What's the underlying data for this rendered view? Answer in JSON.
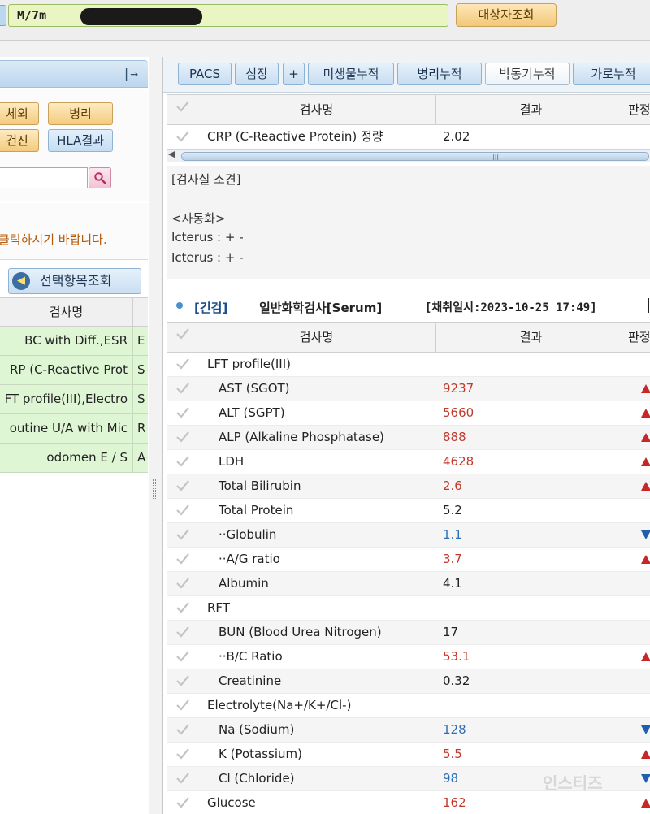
{
  "topbar": {
    "patient_info": "M/7m",
    "lookup_button": "대상자조회"
  },
  "left_panel": {
    "header_icon": "collapse-right-icon",
    "buttons": [
      {
        "label": "체외",
        "style": "orange"
      },
      {
        "label": "병리",
        "style": "orange"
      },
      {
        "label": "건진",
        "style": "orange"
      },
      {
        "label": "HLA결과",
        "style": "blue"
      }
    ],
    "search": {
      "value": "",
      "icon": "search-icon"
    },
    "notice": "클릭하시기 바랍니다.",
    "select_button": "선택항목조회",
    "table": {
      "header": "검사명",
      "rows": [
        {
          "name": "BC with Diff.,ESR",
          "code": "E"
        },
        {
          "name": "RP (C-Reactive Prot",
          "code": "S"
        },
        {
          "name": "FT profile(III),Electro",
          "code": "S"
        },
        {
          "name": "outine U/A with Mic",
          "code": "R"
        },
        {
          "name": "odomen E / S",
          "code": "A"
        }
      ]
    }
  },
  "tabs": [
    {
      "label": "PACS",
      "active": false
    },
    {
      "label": "심장",
      "active": false
    },
    {
      "label": "+",
      "active": false
    },
    {
      "label": "미생물누적",
      "active": false
    },
    {
      "label": "병리누적",
      "active": false
    },
    {
      "label": "박동기누적",
      "active": true
    },
    {
      "label": "가로누적",
      "active": false
    }
  ],
  "grid_headers": {
    "name": "검사명",
    "result": "결과",
    "flag": "판정"
  },
  "top_grid": {
    "rows": [
      {
        "name": "CRP (C-Reactive Protein) 정량",
        "result": "2.02"
      }
    ]
  },
  "opinion": {
    "title": "[검사실 소견]",
    "lines": [
      "<자동화>",
      "Icterus : + -",
      "Icterus : + -"
    ]
  },
  "section": {
    "tag": "[긴검]",
    "name": "일반화학검사[Serum]",
    "collected": "[채취일시:2023-10-25 17:49]"
  },
  "results": [
    {
      "name": "LFT profile(III)",
      "result": "",
      "level": "group",
      "status": "normal"
    },
    {
      "name": "AST (SGOT)",
      "result": "9237",
      "level": "item",
      "status": "high"
    },
    {
      "name": "ALT (SGPT)",
      "result": "5660",
      "level": "item",
      "status": "high"
    },
    {
      "name": "ALP (Alkaline Phosphatase)",
      "result": "888",
      "level": "item",
      "status": "high"
    },
    {
      "name": "LDH",
      "result": "4628",
      "level": "item",
      "status": "high"
    },
    {
      "name": "Total Bilirubin",
      "result": "2.6",
      "level": "item",
      "status": "high"
    },
    {
      "name": "Total Protein",
      "result": "5.2",
      "level": "item",
      "status": "normal"
    },
    {
      "name": "··Globulin",
      "result": "1.1",
      "level": "item",
      "status": "low"
    },
    {
      "name": "··A/G ratio",
      "result": "3.7",
      "level": "item",
      "status": "high"
    },
    {
      "name": "Albumin",
      "result": "4.1",
      "level": "item",
      "status": "normal"
    },
    {
      "name": "RFT",
      "result": "",
      "level": "group",
      "status": "normal"
    },
    {
      "name": "BUN (Blood Urea Nitrogen)",
      "result": "17",
      "level": "item",
      "status": "normal"
    },
    {
      "name": "··B/C Ratio",
      "result": "53.1",
      "level": "item",
      "status": "high"
    },
    {
      "name": "Creatinine",
      "result": "0.32",
      "level": "item",
      "status": "normal"
    },
    {
      "name": "Electrolyte(Na+/K+/Cl-)",
      "result": "",
      "level": "group",
      "status": "normal"
    },
    {
      "name": "Na (Sodium)",
      "result": "128",
      "level": "item",
      "status": "low"
    },
    {
      "name": "K (Potassium)",
      "result": "5.5",
      "level": "item",
      "status": "high"
    },
    {
      "name": "Cl (Chloride)",
      "result": "98",
      "level": "item",
      "status": "low"
    },
    {
      "name": "Glucose",
      "result": "162",
      "level": "group",
      "status": "high"
    }
  ],
  "watermark": "인스티즈",
  "colors": {
    "high": "#c0392b",
    "low": "#2e6fb5",
    "high_flag": "#c62828",
    "low_flag": "#1f5fae"
  }
}
